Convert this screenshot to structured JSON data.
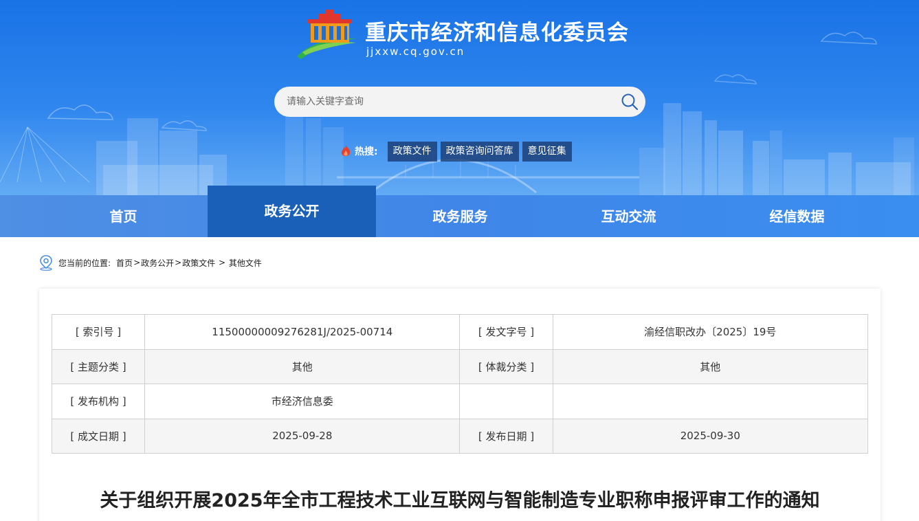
{
  "header": {
    "site_title": "重庆市经济和信息化委员会",
    "site_domain": "jjxxw.cq.gov.cn",
    "logo_icon": "chongqing-building-logo-icon"
  },
  "search": {
    "placeholder": "请输入关键字查询",
    "icon": "search-icon"
  },
  "hot_search": {
    "label": "热搜:",
    "icon": "flame-icon",
    "tags": [
      "政策文件",
      "政策咨询问答库",
      "意见征集"
    ]
  },
  "nav": {
    "items": [
      "首页",
      "政务公开",
      "政务服务",
      "互动交流",
      "经信数据"
    ],
    "active": "政务公开"
  },
  "breadcrumb": {
    "icon": "location-pin-icon",
    "prefix": "您当前的位置:",
    "items": [
      "首页",
      "政务公开",
      "政策文件",
      "其他文件"
    ],
    "sep": ">",
    "last_sep": " > "
  },
  "meta_table": {
    "rows": [
      [
        "[ 索引号 ]",
        "11500000009276281J/2025-00714",
        "[ 发文字号 ]",
        "渝经信职改办〔2025〕19号"
      ],
      [
        "[ 主题分类 ]",
        "其他",
        "[ 体裁分类 ]",
        "其他"
      ],
      [
        "[ 发布机构 ]",
        "市经济信息委",
        "",
        ""
      ],
      [
        "[ 成文日期 ]",
        "2025-09-28",
        "[ 发布日期 ]",
        "2025-09-30"
      ]
    ]
  },
  "document": {
    "title": "关于组织开展2025年全市工程技术工业互联网与智能制造专业职称申报评审工作的通知"
  },
  "colors": {
    "banner": "#1a73e6",
    "nav": "#3f86e8",
    "nav_active": "#1a5fb8",
    "hot_tag_bg": "#18386e"
  }
}
